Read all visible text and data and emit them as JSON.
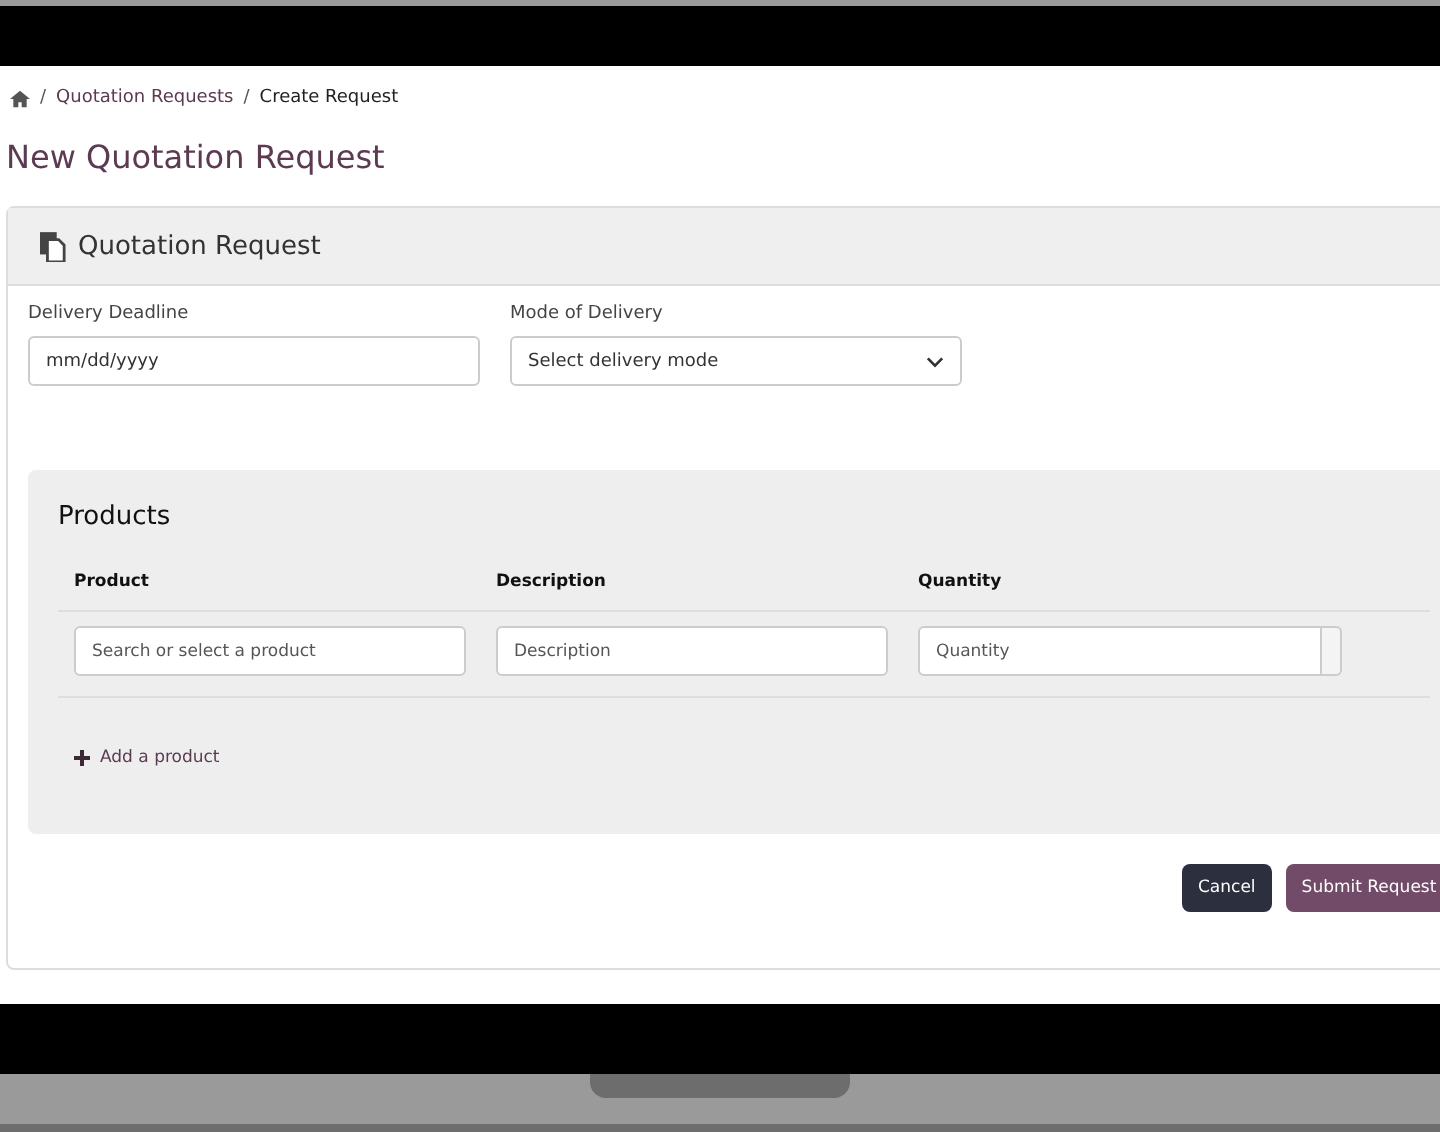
{
  "breadcrumb": {
    "separator": "/",
    "items": [
      "Quotation Requests",
      "Create Request"
    ]
  },
  "page_title": "New Quotation Request",
  "card": {
    "title": "Quotation Request",
    "fields": [
      {
        "label": "Delivery Deadline",
        "kind": "date",
        "placeholder": "mm/dd/yyyy"
      },
      {
        "label": "Mode of Delivery",
        "kind": "select",
        "placeholder": "Select delivery mode"
      }
    ],
    "products": {
      "title": "Products",
      "columns": [
        "Product",
        "Description",
        "Quantity"
      ],
      "row": [
        {
          "placeholder": "Search or select a product",
          "kind": "text"
        },
        {
          "placeholder": "Description",
          "kind": "text"
        },
        {
          "placeholder": "Quantity",
          "kind": "number"
        }
      ],
      "add_link": "Add a product"
    },
    "buttons": [
      {
        "label": "Cancel",
        "kind": "secondary"
      },
      {
        "label": "Submit Request",
        "kind": "primary"
      }
    ]
  }
}
